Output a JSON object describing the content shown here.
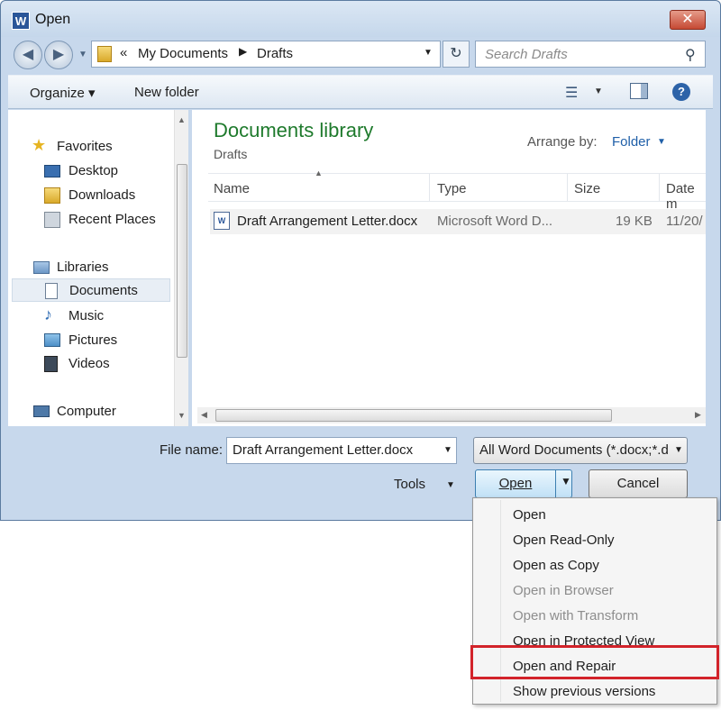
{
  "window": {
    "title": "Open",
    "app_icon": "W"
  },
  "address": {
    "overflow": "«",
    "crumbs": [
      "My Documents",
      "Drafts"
    ],
    "search_placeholder": "Search Drafts"
  },
  "toolbar": {
    "organize": "Organize ▾",
    "new_folder": "New folder"
  },
  "nav": {
    "favorites": "Favorites",
    "desktop": "Desktop",
    "downloads": "Downloads",
    "recent": "Recent Places",
    "libraries": "Libraries",
    "documents": "Documents",
    "music": "Music",
    "pictures": "Pictures",
    "videos": "Videos",
    "computer": "Computer"
  },
  "content": {
    "library_title": "Documents library",
    "library_sub": "Drafts",
    "arrange_label": "Arrange by:",
    "arrange_value": "Folder",
    "columns": [
      "Name",
      "Type",
      "Size",
      "Date m"
    ],
    "files": [
      {
        "name": "Draft Arrangement Letter.docx",
        "type": "Microsoft Word D...",
        "size": "19 KB",
        "date": "11/20/"
      }
    ]
  },
  "bottom": {
    "filename_label": "File name:",
    "filename_value": "Draft Arrangement Letter.docx",
    "filetype_value": "All Word Documents (*.docx;*.d",
    "tools": "Tools",
    "open": "Open",
    "cancel": "Cancel"
  },
  "menu": {
    "items": [
      {
        "label": "Open",
        "enabled": true
      },
      {
        "label": "Open Read-Only",
        "enabled": true
      },
      {
        "label": "Open as Copy",
        "enabled": true
      },
      {
        "label": "Open in Browser",
        "enabled": false
      },
      {
        "label": "Open with Transform",
        "enabled": false
      },
      {
        "label": "Open in Protected View",
        "enabled": true
      },
      {
        "label": "Open and Repair",
        "enabled": true
      },
      {
        "label": "Show previous versions",
        "enabled": true
      }
    ],
    "highlight_color": "#d2232a"
  },
  "colors": {
    "library_title": "#1e7a2c",
    "link": "#1f5fa8"
  }
}
